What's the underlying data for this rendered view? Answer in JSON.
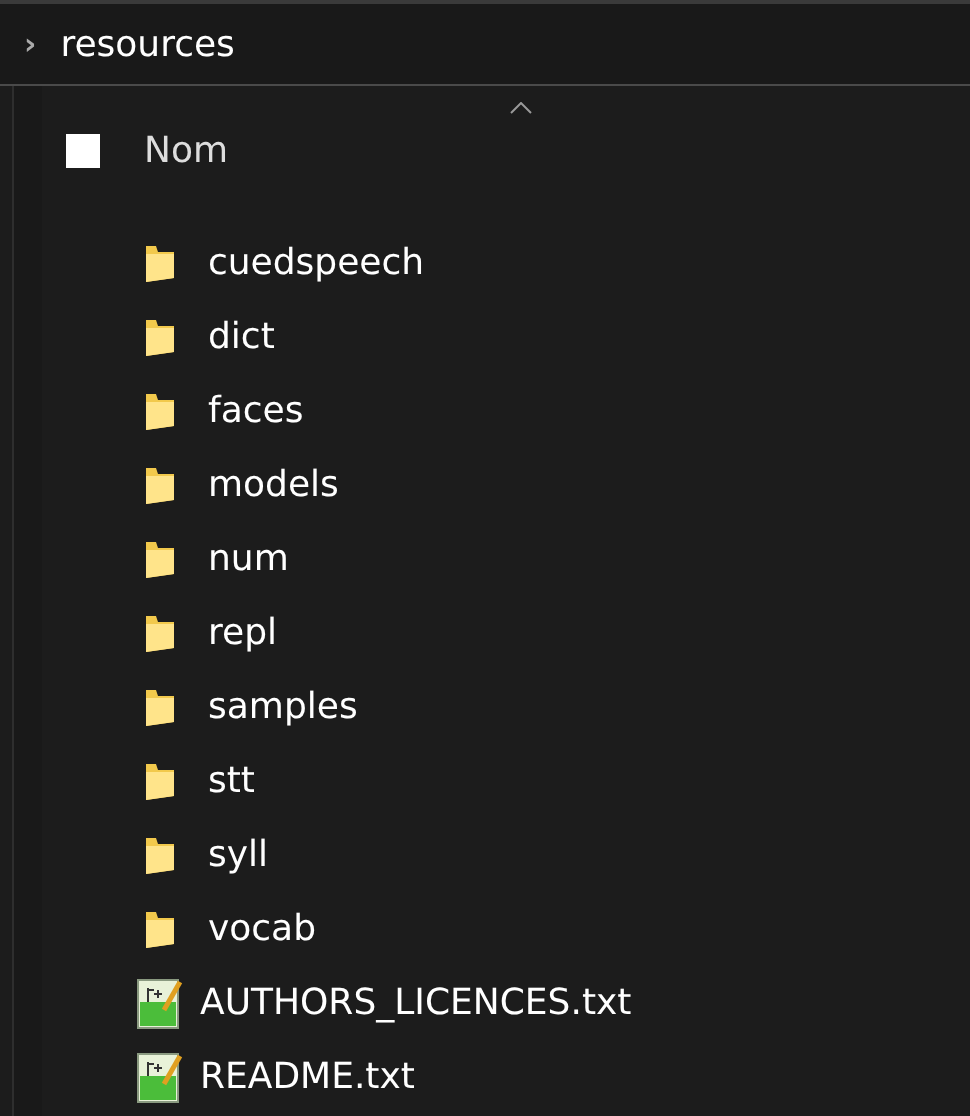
{
  "breadcrumb": {
    "separator": "›",
    "folder": "resources"
  },
  "header": {
    "column": "Nom",
    "checked": false
  },
  "items": [
    {
      "kind": "folder",
      "name": "cuedspeech"
    },
    {
      "kind": "folder",
      "name": "dict"
    },
    {
      "kind": "folder",
      "name": "faces"
    },
    {
      "kind": "folder",
      "name": "models"
    },
    {
      "kind": "folder",
      "name": "num"
    },
    {
      "kind": "folder",
      "name": "repl"
    },
    {
      "kind": "folder",
      "name": "samples"
    },
    {
      "kind": "folder",
      "name": "stt"
    },
    {
      "kind": "folder",
      "name": "syll"
    },
    {
      "kind": "folder",
      "name": "vocab"
    },
    {
      "kind": "file",
      "name": "AUTHORS_LICENCES.txt"
    },
    {
      "kind": "file",
      "name": "README.txt"
    }
  ]
}
